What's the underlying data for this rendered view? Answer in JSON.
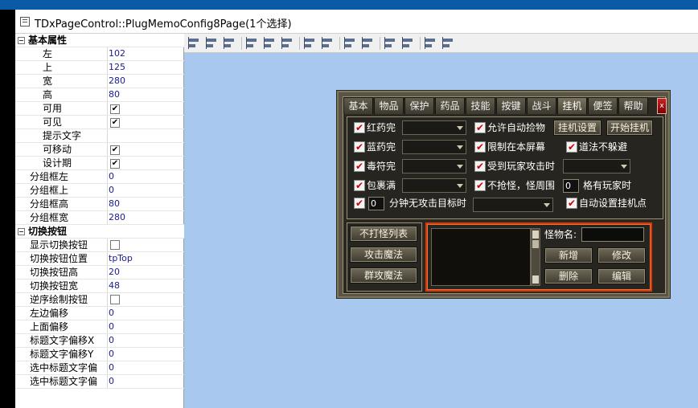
{
  "window": {
    "title": "TDxPageControl::PlugMemoConfig8Page(1个选择)"
  },
  "inspector": {
    "rows": [
      {
        "type": "cat",
        "name": "基本属性"
      },
      {
        "type": "prop",
        "name": "左",
        "indent": 2,
        "value": "102"
      },
      {
        "type": "prop",
        "name": "上",
        "indent": 2,
        "value": "125"
      },
      {
        "type": "prop",
        "name": "宽",
        "indent": 2,
        "value": "280"
      },
      {
        "type": "prop",
        "name": "高",
        "indent": 2,
        "value": "80"
      },
      {
        "type": "bool",
        "name": "可用",
        "indent": 2,
        "value": "✔"
      },
      {
        "type": "bool",
        "name": "可见",
        "indent": 2,
        "value": "✔"
      },
      {
        "type": "prop",
        "name": "提示文字",
        "indent": 2,
        "value": ""
      },
      {
        "type": "bool",
        "name": "可移动",
        "indent": 2,
        "value": "✔"
      },
      {
        "type": "bool",
        "name": "设计期",
        "indent": 2,
        "value": "✔"
      },
      {
        "type": "prop",
        "name": "分组框左",
        "indent": 1,
        "value": "0"
      },
      {
        "type": "prop",
        "name": "分组框上",
        "indent": 1,
        "value": "0"
      },
      {
        "type": "prop",
        "name": "分组框高",
        "indent": 1,
        "value": "80"
      },
      {
        "type": "prop",
        "name": "分组框宽",
        "indent": 1,
        "value": "280"
      },
      {
        "type": "cat",
        "name": "切换按钮"
      },
      {
        "type": "bool",
        "name": "显示切换按钮",
        "indent": 1,
        "value": ""
      },
      {
        "type": "prop",
        "name": "切换按钮位置",
        "indent": 1,
        "value": "tpTop"
      },
      {
        "type": "prop",
        "name": "切换按钮高",
        "indent": 1,
        "value": "20"
      },
      {
        "type": "prop",
        "name": "切换按钮宽",
        "indent": 1,
        "value": "48"
      },
      {
        "type": "bool",
        "name": "逆序绘制按钮",
        "indent": 1,
        "value": ""
      },
      {
        "type": "prop",
        "name": "左边偏移",
        "indent": 1,
        "value": "0"
      },
      {
        "type": "prop",
        "name": "上面偏移",
        "indent": 1,
        "value": "0"
      },
      {
        "type": "prop",
        "name": "标题文字偏移X",
        "indent": 1,
        "value": "0"
      },
      {
        "type": "prop",
        "name": "标题文字偏移Y",
        "indent": 1,
        "value": "0"
      },
      {
        "type": "prop",
        "name": "选中标题文字偏",
        "indent": 1,
        "value": "0"
      },
      {
        "type": "prop",
        "name": "选中标题文字偏",
        "indent": 1,
        "value": "0"
      }
    ]
  },
  "game": {
    "tabs": [
      "基本",
      "物品",
      "保护",
      "药品",
      "技能",
      "按键",
      "战斗",
      "挂机",
      "便签",
      "帮助"
    ],
    "active_tab": "挂机",
    "close_label": "x",
    "check_mark": "✔",
    "labels": {
      "red_potion": "红药完",
      "blue_potion": "蓝药完",
      "poison": "毒符完",
      "bag_full": "包裹满",
      "minutes_num": "0",
      "minutes_text": "分钟无攻击目标时",
      "auto_pickup": "允许自动捡物",
      "limit_screen": "限制在本屏幕",
      "attacked": "受到玩家攻击时",
      "no_grab": "不抢怪，怪周围",
      "grid_num": "0",
      "grid_text": "格有玩家时",
      "daoshi": "道法不躲避",
      "auto_point": "自动设置挂机点",
      "monster_name": "怪物名:"
    },
    "buttons": {
      "guaji_settings": "挂机设置",
      "start_guaji": "开始挂机",
      "no_hit_list": "不打怪列表",
      "attack_magic": "攻击魔法",
      "group_magic": "群攻魔法",
      "add": "新增",
      "modify": "修改",
      "delete": "删除",
      "edit": "编辑"
    }
  }
}
